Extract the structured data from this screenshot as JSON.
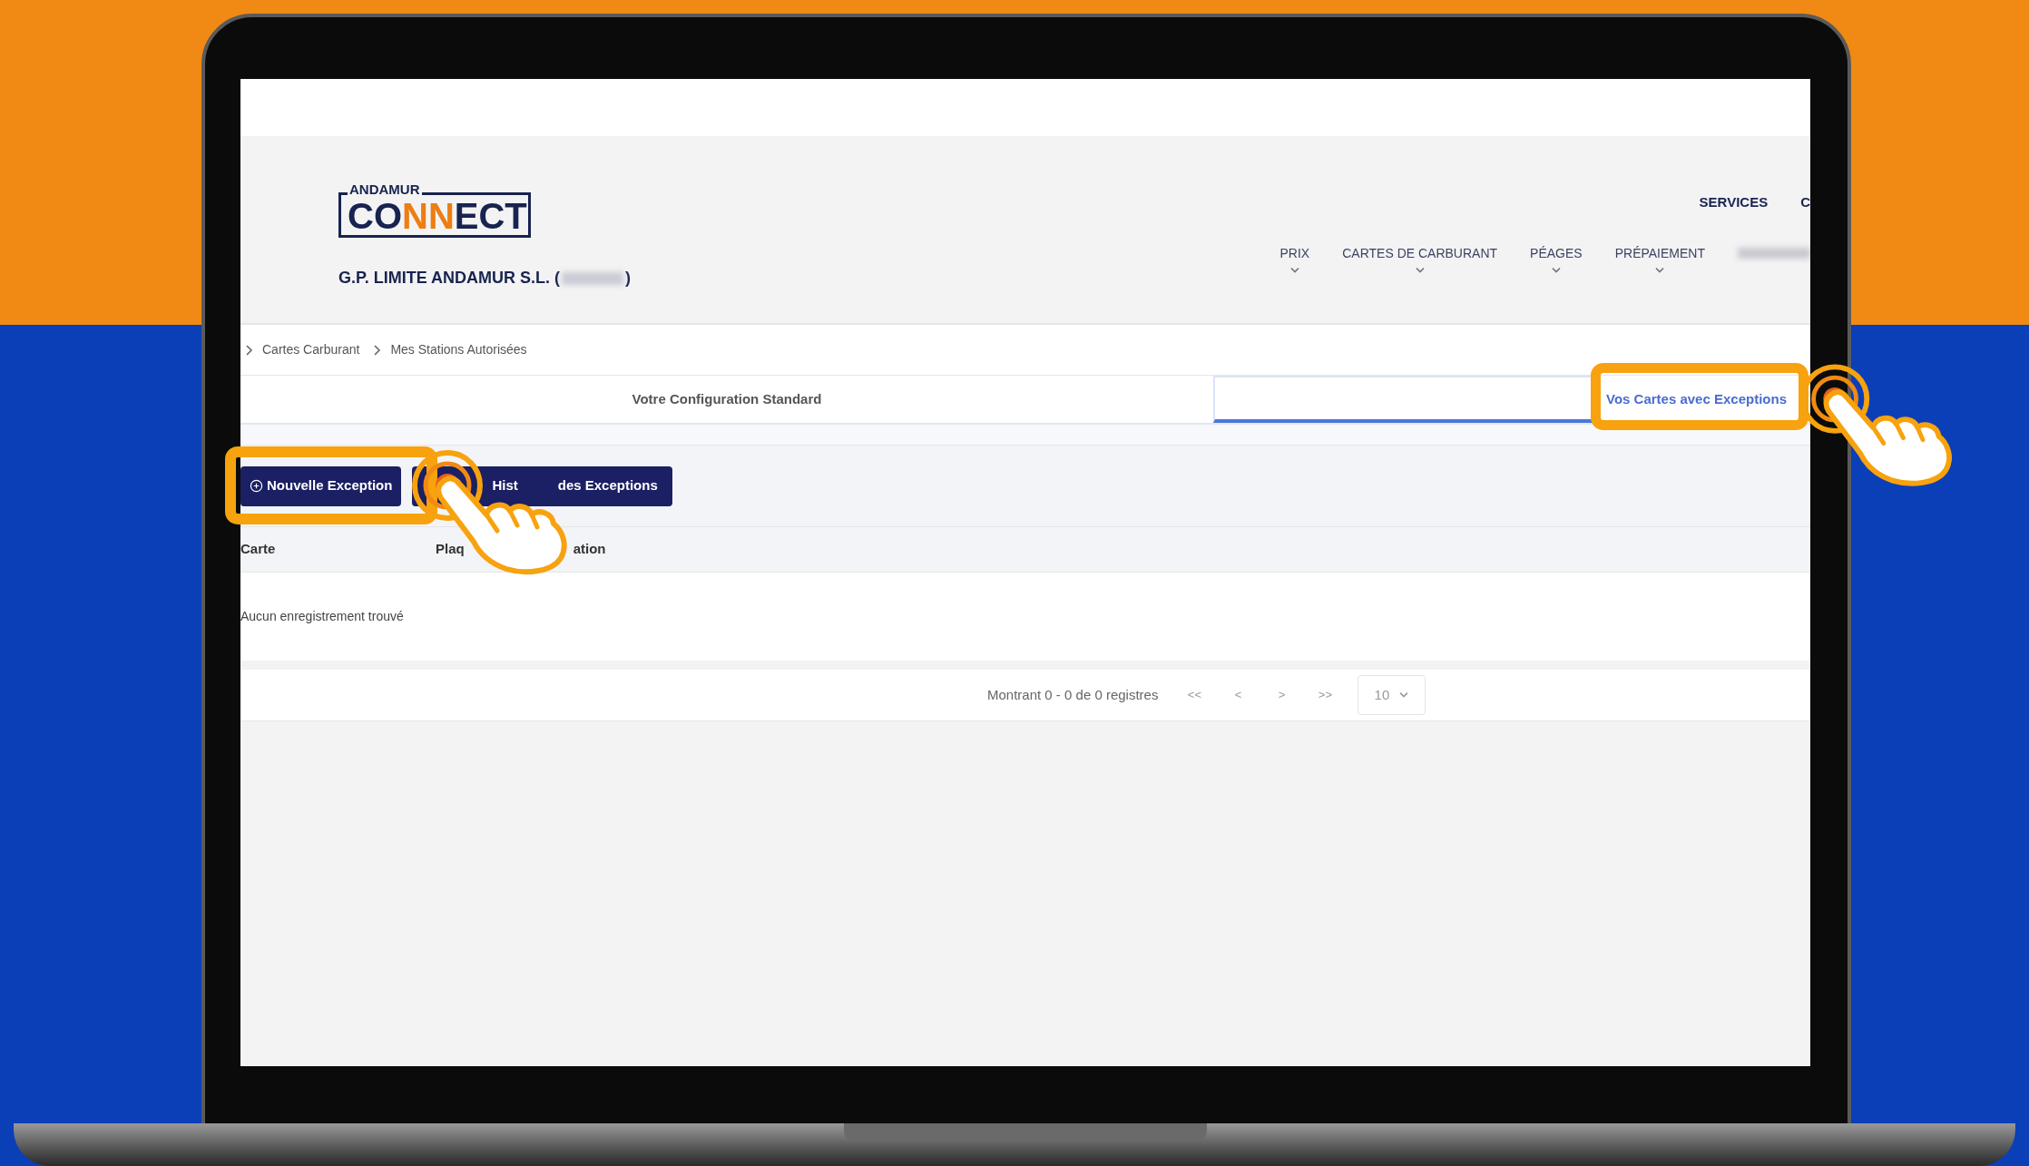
{
  "logo": {
    "top": "ANDAMUR",
    "segments": [
      {
        "text": "CO",
        "accent": false
      },
      {
        "text": "NN",
        "accent": true
      },
      {
        "text": "ECT",
        "accent": false
      }
    ]
  },
  "company": {
    "name": "G.P. LIMITE ANDAMUR S.L. (",
    "suffix": ")",
    "redacted": true
  },
  "top_nav": [
    "SERVICES",
    "C"
  ],
  "nav": [
    {
      "label": "PRIX",
      "redacted": false
    },
    {
      "label": "CARTES DE CARBURANT",
      "redacted": false
    },
    {
      "label": "PÉAGES",
      "redacted": false
    },
    {
      "label": "PRÉPAIEMENT",
      "redacted": false
    },
    {
      "redacted": true
    }
  ],
  "breadcrumb": [
    "Cartes Carburant",
    "Mes Stations Autorisées"
  ],
  "tabs": [
    {
      "label": "Votre Configuration Standard",
      "selected": false
    },
    {
      "label": "Vos Cartes avec Exceptions",
      "selected": true
    }
  ],
  "buttons": [
    {
      "kind": "add",
      "parts": [
        "Nouvelle Exception"
      ],
      "highlighted": true
    },
    {
      "kind": "history",
      "parts": [
        "Hist",
        "des Exceptions"
      ],
      "highlighted": false
    }
  ],
  "table": {
    "columns": [
      {
        "parts": [
          "Carte"
        ]
      },
      {
        "parts": [
          "Plaq",
          "ation"
        ]
      }
    ],
    "empty_text": "Aucun enregistrement trouvé"
  },
  "pagination": {
    "summary": "Montrant 0 - 0 de 0 registres",
    "controls": [
      "<<",
      "<",
      ">",
      ">>"
    ],
    "page_size": "10"
  }
}
